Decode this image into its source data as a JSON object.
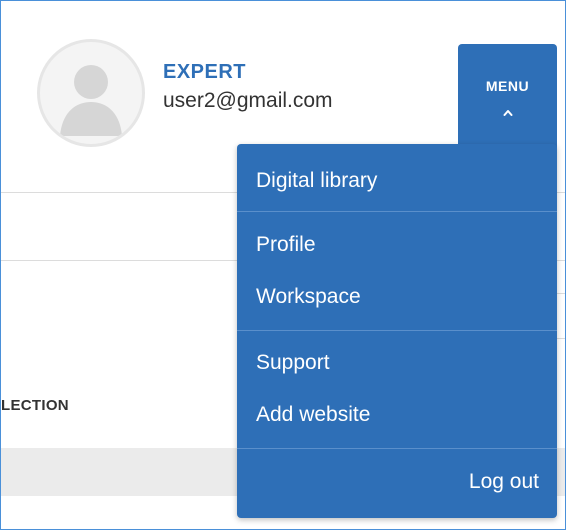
{
  "user": {
    "role": "EXPERT",
    "email": "user2@gmail.com"
  },
  "menu_button": {
    "label": "MENU"
  },
  "menu": {
    "items": [
      {
        "label": "Digital library"
      },
      {
        "label": "Profile"
      },
      {
        "label": "Workspace"
      },
      {
        "label": "Support"
      },
      {
        "label": "Add website"
      },
      {
        "label": "Log out"
      }
    ]
  },
  "page": {
    "collection_label": "LECTION"
  },
  "colors": {
    "accent": "#2e6fb7",
    "menu_text": "#ffffff",
    "gray_band": "#ebebeb"
  },
  "icons": {
    "avatar": "default-user-silhouette",
    "menu_chevron": "chevron-up-icon"
  }
}
